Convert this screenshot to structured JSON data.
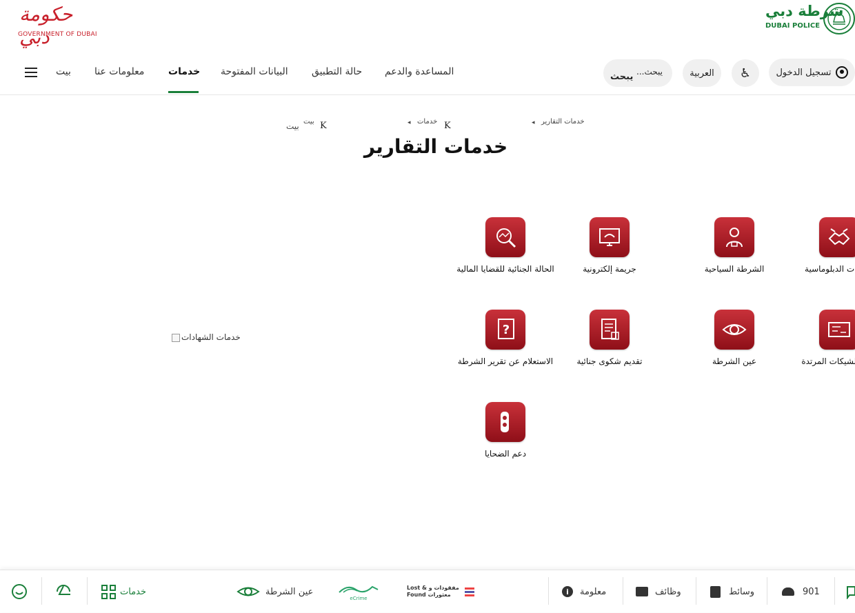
{
  "header": {
    "gov_logo_ar": "حكومة دبي",
    "gov_logo_en": "GOVERNMENT OF DUBAI",
    "police_logo_ar": "شرطة دبي",
    "police_logo_en": "DUBAI POLICE",
    "login_label": "تسجيل الدخول",
    "language_label": "العربية",
    "search_placeholder": "...يبحث",
    "search_typed": "يبحث"
  },
  "nav": {
    "items": [
      "بيت",
      "معلومات عنا",
      "خدمات",
      "البيانات المفتوحة",
      "حالة التطبيق",
      "المساعدة والدعم"
    ],
    "active_index": 2
  },
  "breadcrumb": {
    "items": [
      "خدمات التقارير",
      "خدمات",
      "بيت"
    ],
    "separator": "K",
    "home_alt": "بيت"
  },
  "page_title": "خدمات التقارير",
  "services": [
    {
      "label": "لخدمات الدبلوماسية",
      "icon": "handshake-icon"
    },
    {
      "label": "الشرطة السياحية",
      "icon": "tourist-police-icon"
    },
    {
      "label": "جريمة إلكترونية",
      "icon": "cyber-crime-icon"
    },
    {
      "label": "الحالة الجنائية للقضايا المالية",
      "icon": "financial-search-icon"
    },
    {
      "label": "قرير الشيكات المرتدة",
      "icon": "cheque-icon"
    },
    {
      "label": "عين الشرطة",
      "icon": "eye-icon"
    },
    {
      "label": "تقديم شكوى جنائية",
      "icon": "complaint-doc-icon"
    },
    {
      "label": "الاستعلام عن تقرير الشرطة",
      "icon": "question-doc-icon"
    },
    {
      "label": "دعم الضحايا",
      "icon": "victim-support-icon"
    }
  ],
  "certificates_image_alt": "خدمات الشهادات",
  "bottom_bar": {
    "feedback_icon": "chat-icon",
    "phone": "901",
    "media": "وسائط",
    "jobs": "وظائف",
    "info": "معلومة",
    "lost_found_ar": "مفقودات و",
    "lost_found_ar2": "معثورات",
    "lost_found_en": "Lost &",
    "lost_found_en2": "Found",
    "ecrime": "eCrime",
    "police_eye": "عين الشرطة",
    "services": "خدمات"
  },
  "colors": {
    "brand_green": "#1a7f3a",
    "gov_red": "#c8202b",
    "tile_red": "#a8202a"
  }
}
